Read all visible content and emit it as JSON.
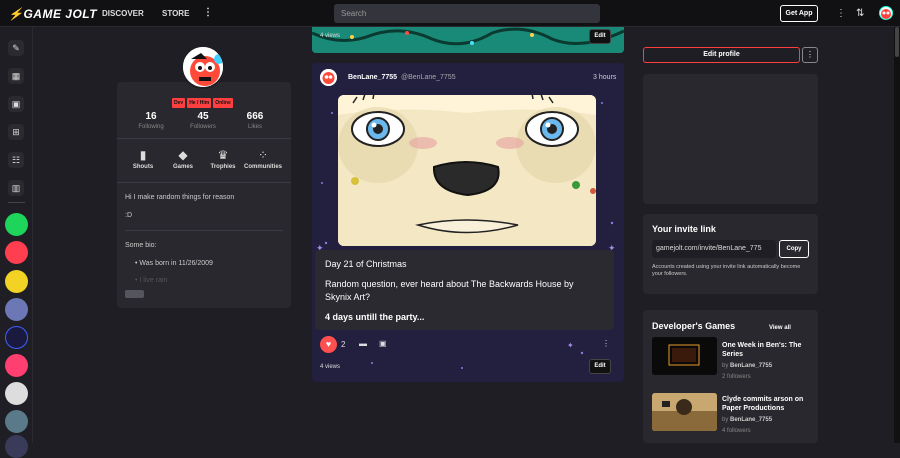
{
  "topbar": {
    "logo": "⚡GAME JOLT",
    "discover": "DISCOVER",
    "store": "STORE",
    "more": "⋮",
    "search_placeholder": "Search",
    "get_app": "Get App",
    "more_icon": "⋮",
    "people_icon": "⇅"
  },
  "profile": {
    "badges": [
      "Dev",
      "He / Him",
      "Online"
    ],
    "stats": [
      {
        "num": "16",
        "label": "Following"
      },
      {
        "num": "45",
        "label": "Followers"
      },
      {
        "num": "666",
        "label": "Likes"
      }
    ],
    "tabs": [
      {
        "icon": "speech-bubble-icon",
        "label": "Shouts"
      },
      {
        "icon": "gamepad-icon",
        "label": "Games"
      },
      {
        "icon": "trophy-icon",
        "label": "Trophies"
      },
      {
        "icon": "communities-icon",
        "label": "Communities"
      }
    ],
    "bio_line1": "Hi I make random things for reason",
    "bio_line2": ":D",
    "bio_heading": "Some bio:",
    "bio_item1": "Was born in 11/26/2009",
    "bio_item2": "I live rain"
  },
  "post_top": {
    "views": "4 views",
    "edit": "Edit"
  },
  "post": {
    "user": "BenLane_7755",
    "handle": "@BenLane_7755",
    "time": "3 hours",
    "line1": "Day 21 of Christmas",
    "line2": "Random question, ever heard about The Backwards House by",
    "line3": "Skynix Art?",
    "line4": "4 days untill the party...",
    "likes": "2",
    "views": "4 views",
    "edit": "Edit",
    "more": "⋮"
  },
  "sidebar": {
    "edit_profile": "Edit profile",
    "more": "⋮",
    "invite_title": "Your invite link",
    "invite_link": "gamejolt.com/invite/BenLane_775",
    "copy": "Copy",
    "invite_note": "Accounts created using your invite link automatically become your followers.",
    "games_title": "Developer's Games",
    "view_all": "View all",
    "games": [
      {
        "title_line1": "One Week in Ben's: The",
        "title_line2": "Series",
        "by_prefix": "by",
        "by": "BenLane_7755",
        "followers": "2 followers"
      },
      {
        "title_line1": "Clyde commits arson on",
        "title_line2": "Paper Productions",
        "by_prefix": "by",
        "by": "BenLane_7755",
        "followers": "4 followers"
      }
    ]
  },
  "colors": {
    "accent": "#ff3f3f",
    "bg": "#1e1e24",
    "card": "#28282e"
  }
}
